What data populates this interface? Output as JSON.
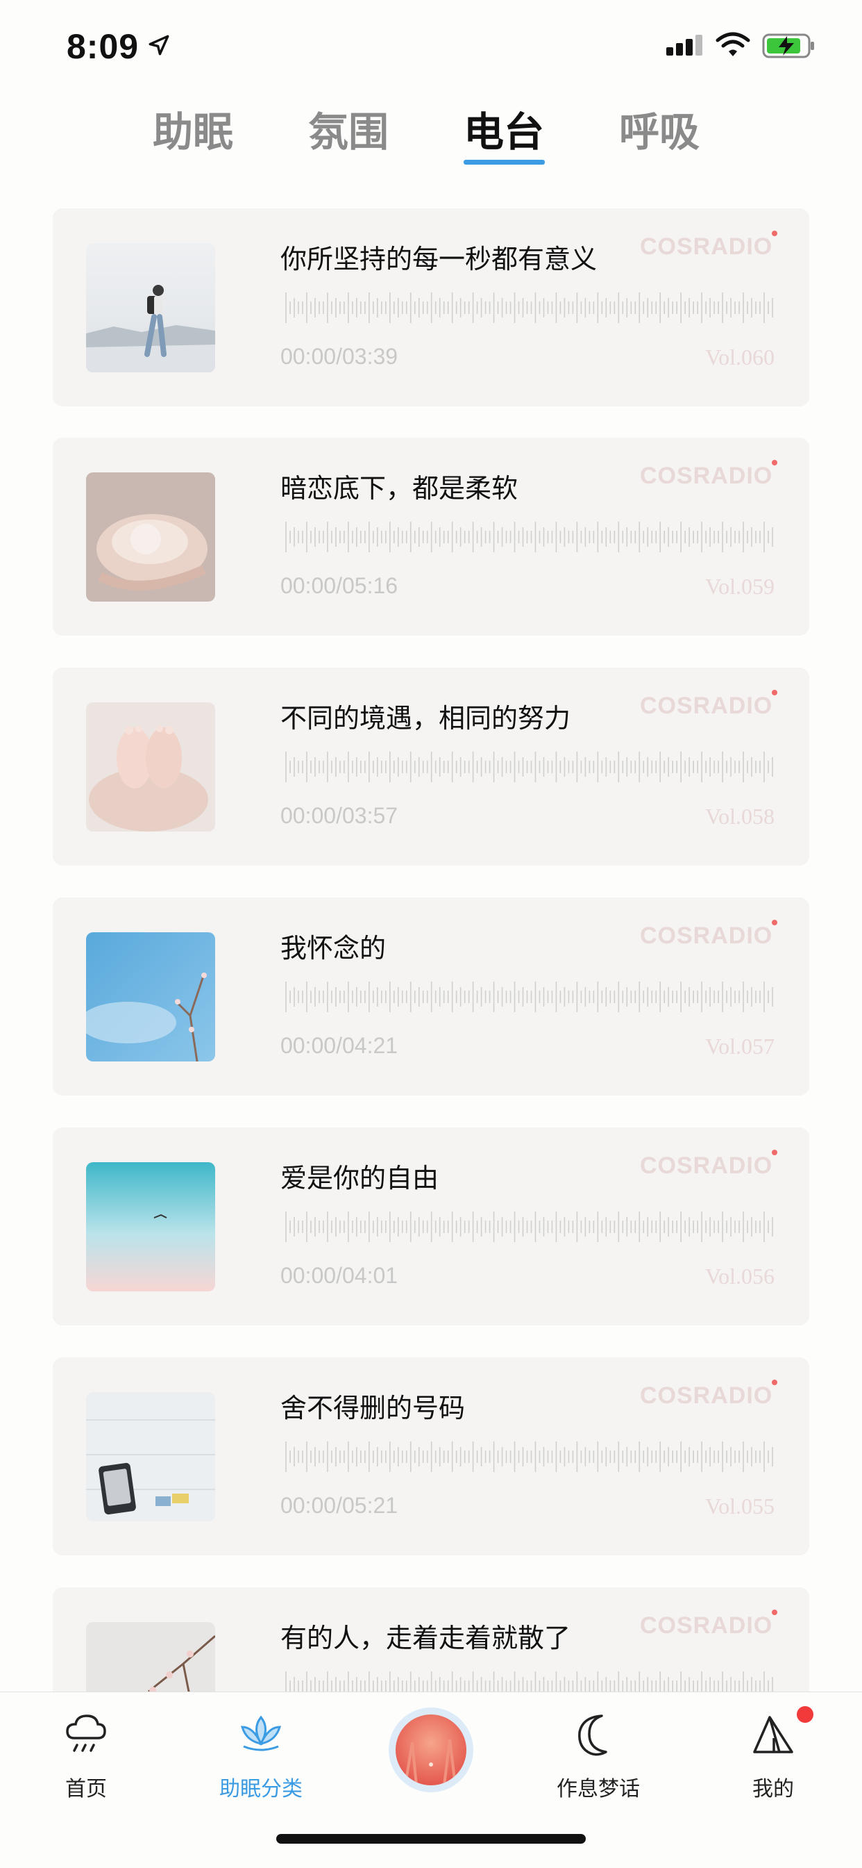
{
  "status_bar": {
    "time": "8:09"
  },
  "tabs": [
    {
      "label": "助眠",
      "active": false
    },
    {
      "label": "氛围",
      "active": false
    },
    {
      "label": "电台",
      "active": true
    },
    {
      "label": "呼吸",
      "active": false
    }
  ],
  "brand_label": "COSRADIO",
  "episodes": [
    {
      "title": "你所坚持的每一秒都有意义",
      "duration": "00:00/03:39",
      "vol": "Vol.060",
      "thumb": "thumb-walker-icon"
    },
    {
      "title": "暗恋底下，都是柔软",
      "duration": "00:00/05:16",
      "vol": "Vol.059",
      "thumb": "thumb-hands-icon"
    },
    {
      "title": "不同的境遇，相同的努力",
      "duration": "00:00/03:57",
      "vol": "Vol.058",
      "thumb": "thumb-baby-feet-icon"
    },
    {
      "title": "我怀念的",
      "duration": "00:00/04:21",
      "vol": "Vol.057",
      "thumb": "thumb-sky-icon"
    },
    {
      "title": "爱是你的自由",
      "duration": "00:00/04:01",
      "vol": "Vol.056",
      "thumb": "thumb-gradient-sky-icon"
    },
    {
      "title": "舍不得删的号码",
      "duration": "00:00/05:21",
      "vol": "Vol.055",
      "thumb": "thumb-phone-icon"
    },
    {
      "title": "有的人，走着走着就散了",
      "duration": "",
      "vol": "",
      "thumb": "thumb-blossom-icon"
    }
  ],
  "tabbar": {
    "items": [
      {
        "label": "首页",
        "icon": "cloud-rain-icon"
      },
      {
        "label": "助眠分类",
        "icon": "lotus-icon",
        "active": true
      },
      {
        "label": "",
        "icon": "center-play-icon"
      },
      {
        "label": "作息梦话",
        "icon": "moon-icon"
      },
      {
        "label": "我的",
        "icon": "tent-icon",
        "badge": true
      }
    ]
  },
  "colors": {
    "accent": "#3b9be3",
    "badge": "#f23a3a",
    "card_bg": "#f5f4f2"
  }
}
